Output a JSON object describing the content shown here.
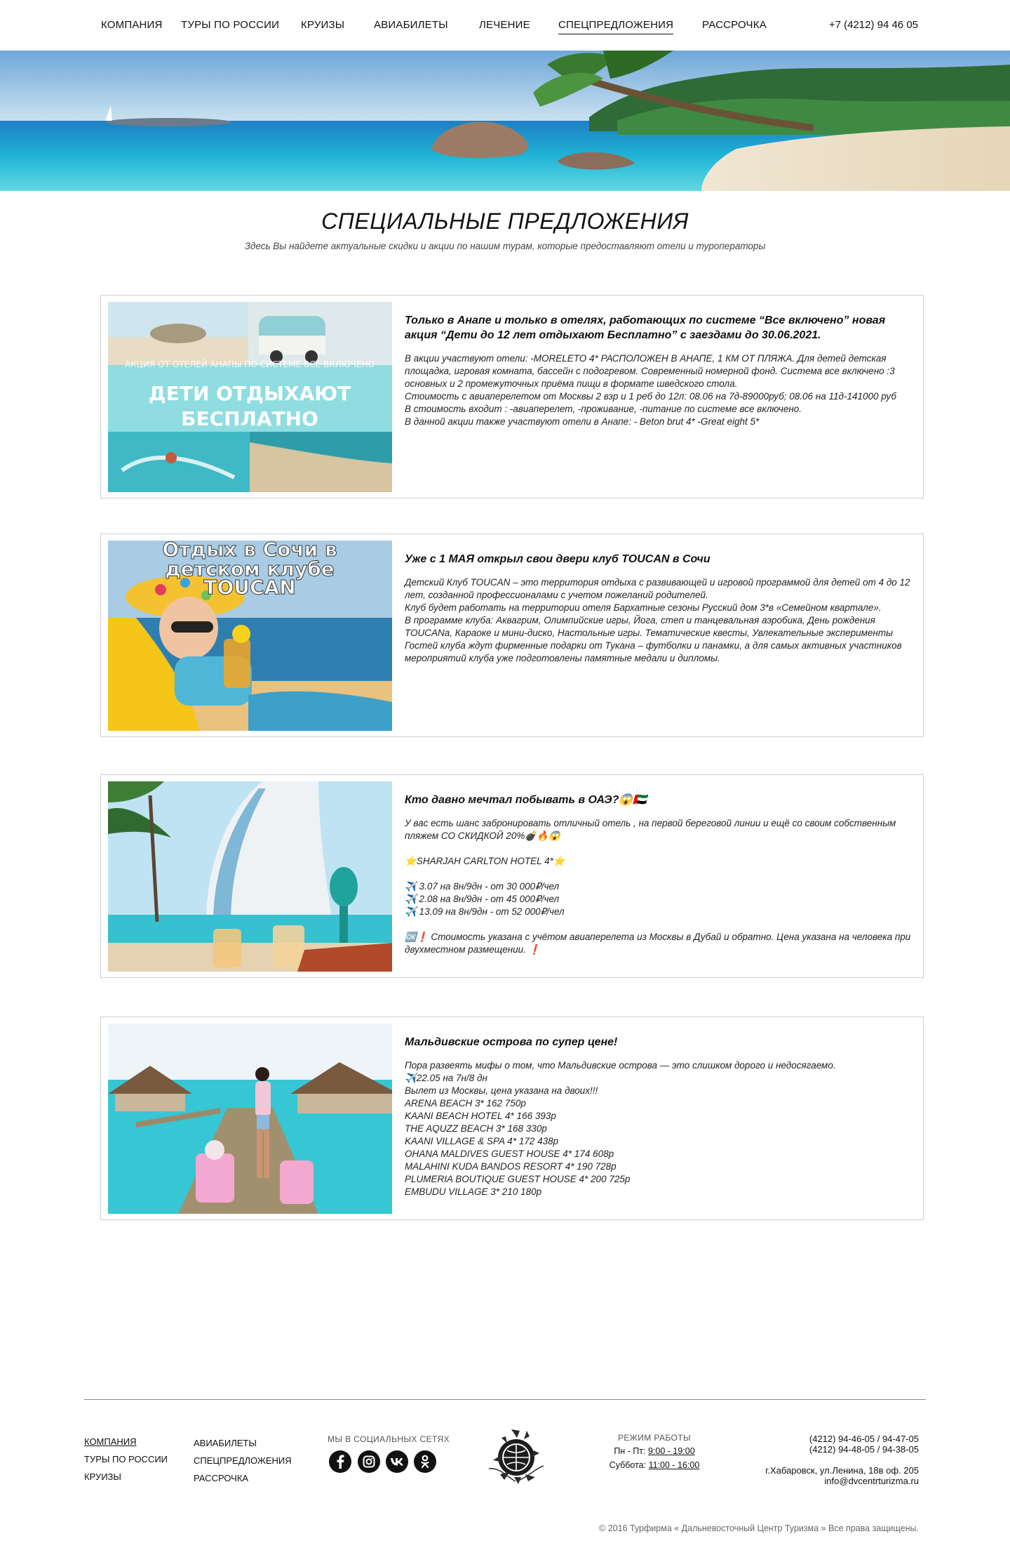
{
  "nav": {
    "items": [
      {
        "label": "Компания"
      },
      {
        "label": "Туры по России"
      },
      {
        "label": "Круизы"
      },
      {
        "label": "Авиабилеты"
      },
      {
        "label": "Лечение"
      },
      {
        "label": "Спецпредложения"
      },
      {
        "label": "Рассрочка"
      }
    ],
    "active_index": 5,
    "phone": "+7 (4212) 94 46 05"
  },
  "hero": {
    "image": "tropical-beach-banner"
  },
  "page": {
    "title": "СПЕЦИАЛЬНЫЕ ПРЕДЛОЖЕНИЯ",
    "subtitle": "Здесь Вы найдете актуальные скидки и акции по нашим турам, которые предоставляют отели и туроператоры"
  },
  "offers": [
    {
      "image_caption_top": "АКЦИЯ ОТ ОТЕЛЕЙ АНАПЫ ПО СИСТЕМЕ ВСЕ ВКЛЮЧЕНО",
      "image_caption_main_1": "ДЕТИ ОТДЫХАЮТ",
      "image_caption_main_2": "БЕСПЛАТНО",
      "title": "Только в Анапе и только в отелях, работающих по системе “Все включено” новая акция “Дети до 12 лет отдыхают Бесплатно” с заездами до 30.06.2021.",
      "text": " В акции участвуют отели:  -MORELETO 4* РАСПОЛОЖЕН В АНАПЕ, 1 КМ ОТ ПЛЯЖА. Для детей детская площадка, игровая комната, бассейн с подогревом. Современный номерной фонд. Система все включено :3 основных и 2 промежуточных приёма пищи в формате шведского стола.\nСтоимость с авиаперелетом от Москвы 2 взр и 1 реб до 12л: 08.06 на 7д-89000руб;  08.06 на 11д-141000 руб\nВ стоимость входит : -авиаперелет, -проживание, -питание по системе все включено.\nВ данной акции также участвуют отели в Анапе:  - Beton brut 4* -Great eight 5*"
    },
    {
      "image_caption_1": "Отдых в Сочи в",
      "image_caption_2": "детском клубе",
      "image_caption_3": "TOUCAN",
      "title": "Уже с 1 МАЯ открыл свои двери клуб TOUCAN в Сочи",
      "text": "Детский Клуб TOUCAN – это территория отдыха с развивающей и игровой программой для детей от 4 до 12 лет, созданной профессионалами с учетом пожеланий родителей.\nКлуб будет работать на территории отеля Бархатные сезоны Русский дом 3*в «Семейном квартале».\nВ программе клуба:  Аквагрим,  Олимпийские игры, Йога, степ и танцевальная аэробика, День рождения TOUCANa, Караоке и мини-диско, Настольные игры. Тематические квесты, Увлекательные эксперименты\nГостей клуба ждут фирменные подарки от Тукана – футболки и панамки, а для самых активных участников мероприятий клуба уже подготовлены памятные медали и дипломы."
    },
    {
      "title": "Кто давно мечтал побывать в ОАЭ?😱🇦🇪",
      "text": "У вас есть шанс забронировать отличный отель , на первой береговой линии и ещё со своим собственным пляжем СО СКИДКОЙ 20%💣🔥😱\n\n⭐SHARJAH CARLTON HOTEL 4*⭐\n\n✈️ 3.07 на 8н/9дн - от 30 000₽/чел\n✈️ 2.08 на 8н/9дн - от 45 000₽/чел\n✈️ 13.09 на 8н/9дн - от 52 000₽/чел\n\n🆗❗ Стоимость указана с учётом авиаперелета из Москвы в Дубай и обратно. Цена указана на человека при двухместном размещении. ❗"
    },
    {
      "title": "Мальдивские острова по супер цене!",
      "text": "Пора развеять мифы о том, что Мальдивские острова — это слишком дорого и недосягаемо.\n✈️22.05 на 7н/8 дн\nВылет из Москвы, цена указана на двоих!!!\nARENA BEACH 3* 162 750р\nKAANI BEACH HOTEL 4* 166 393р\nTHE AQUZZ BEACH 3* 168 330р\nKAANI VILLAGE & SPA 4* 172 438р\nOHANA MALDIVES GUEST HOUSE 4* 174 608р\nMALAHINI KUDA BANDOS RESORT 4* 190 728р\nPLUMERIA BOUTIQUE GUEST HOUSE 4* 200 725р\nEMBUDU VILLAGE 3* 210 180р"
    }
  ],
  "footer": {
    "col1": [
      "Компания",
      "Туры по России",
      "Круизы"
    ],
    "col2": [
      "Авиабилеты",
      "Спецпредложения",
      "Рассрочка"
    ],
    "social_title": "МЫ В СОЦИАЛЬНЫХ СЕТЯХ",
    "social_icons": [
      "facebook-icon",
      "instagram-icon",
      "vk-icon",
      "odnoklassniki-icon"
    ],
    "hours_title": "РЕЖИМ РАБОТЫ",
    "weekdays_label": "Пн - Пт: ",
    "weekdays_time": "9:00 - 19:00",
    "saturday_label": "Суббота: ",
    "saturday_time": "11:00 - 16:00",
    "phones_1": "(4212) 94-46-05 / 94-47-05",
    "phones_2": "(4212) 94-48-05 / 94-38-05",
    "address": "г.Хабаровск, ул.Ленина, 18в оф. 205",
    "email": "info@dvcentrturizma.ru",
    "copyright": "© 2016 Турфирма « Дальневосточный Центр Туризма » Все права защищены."
  }
}
